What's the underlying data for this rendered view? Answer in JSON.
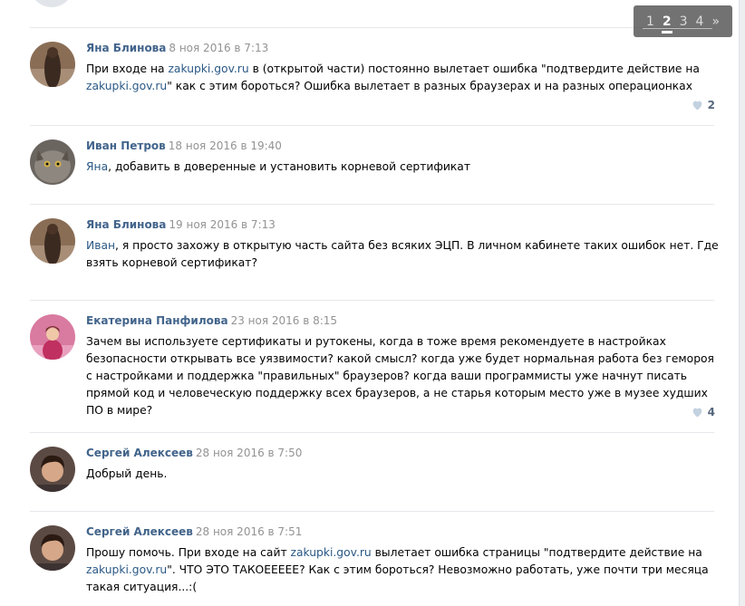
{
  "pager": {
    "pages": [
      "1",
      "2",
      "3",
      "4"
    ],
    "current": "2",
    "next": "»"
  },
  "comments": [
    {
      "author": "Яна Блинова",
      "date": "8 ноя 2016 в 7:13",
      "t1": "При входе на ",
      "l1": "zakupki.gov.ru",
      "t2": " в (открытой части) постоянно вылетает ошибка \"подтвердите действие на ",
      "l2": "zakupki.gov.ru",
      "t3": "\" как с этим бороться? Ошибка вылетает в разных браузерах и на разных операционках",
      "likes": "2"
    },
    {
      "author": "Иван Петров",
      "date": "18 ноя 2016 в 19:40",
      "l1": "Яна",
      "t1": ", добавить в доверенные и установить корневой сертификат"
    },
    {
      "author": "Яна Блинова",
      "date": "19 ноя 2016 в 7:13",
      "l1": "Иван",
      "t1": ", я просто захожу в открытую часть сайта без всяких ЭЦП. В личном кабинете таких ошибок нет. Где взять корневой сертификат?"
    },
    {
      "author": "Екатерина Панфилова",
      "date": "23 ноя 2016 в 8:15",
      "t1": "Зачем вы используете сертификаты и рутокены, когда в тоже время рекомендуете в настройках безопасности открывать все уязвимости? какой смысл? когда уже будет нормальная работа без гемороя с настройками и поддержка \"правильных\" браузеров? когда ваши программисты уже начнут писать прямой код и человеческую поддержку всех браузеров, а не старья которым место уже в музее худших ПО в мире?",
      "likes": "4"
    },
    {
      "author": "Сергей Алексеев",
      "date": "28 ноя 2016 в 7:50",
      "t1": "Добрый день."
    },
    {
      "author": "Сергей Алексеев",
      "date": "28 ноя 2016 в 7:51",
      "t1": "Прошу помочь. При входе на сайт ",
      "l1": "zakupki.gov.ru",
      "t2": " вылетает ошибка страницы \"подтвердите действие на ",
      "l2": "zakupki.gov.ru",
      "t3": "\". ЧТО ЭТО ТАКОЕЕЕЕЕ? Как с этим бороться? Невозможно работать, уже почти три месяца такая ситуация...:("
    }
  ],
  "colors": {
    "author": "#42648b",
    "link": "#2a5885",
    "date": "#939393",
    "like": "#55677d",
    "heart": "#c3d1e0"
  }
}
